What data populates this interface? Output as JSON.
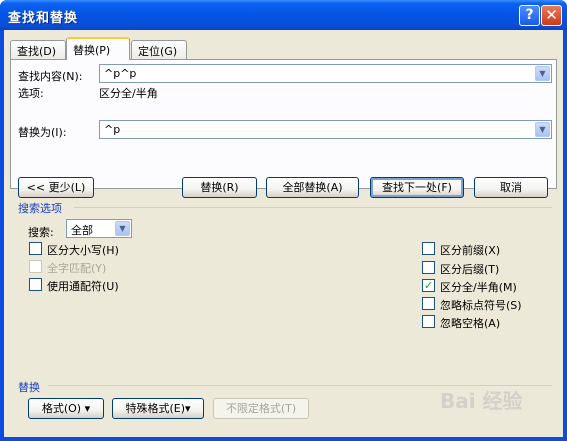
{
  "window": {
    "title": "查找和替换"
  },
  "titlebar": {
    "help_glyph": "?",
    "close_glyph": "✕"
  },
  "tabs": [
    {
      "label": "查找(D)"
    },
    {
      "label": "替换(P)"
    },
    {
      "label": "定位(G)"
    }
  ],
  "find": {
    "label": "查找内容(N):",
    "value": "^p^p"
  },
  "options": {
    "label": "选项:",
    "value": "区分全/半角"
  },
  "replace": {
    "label": "替换为(I):",
    "value": "^p"
  },
  "buttons": {
    "less": "<< 更少(L)",
    "replace": "替换(R)",
    "replace_all": "全部替换(A)",
    "find_next": "查找下一处(F)",
    "cancel": "取消"
  },
  "search_options": {
    "header": "搜索选项",
    "search_label": "搜索:",
    "search_value": "全部",
    "left_checks": [
      {
        "label": "区分大小写(H)",
        "checked": false,
        "disabled": false
      },
      {
        "label": "全字匹配(Y)",
        "checked": false,
        "disabled": true
      },
      {
        "label": "使用通配符(U)",
        "checked": false,
        "disabled": false
      }
    ],
    "right_checks": [
      {
        "label": "区分前缀(X)",
        "checked": false
      },
      {
        "label": "区分后缀(T)",
        "checked": false
      },
      {
        "label": "区分全/半角(M)",
        "checked": true
      },
      {
        "label": "忽略标点符号(S)",
        "checked": false
      },
      {
        "label": "忽略空格(A)",
        "checked": false
      }
    ]
  },
  "replace_section": {
    "header": "替换",
    "format": "格式(O) ▾",
    "special": "特殊格式(E)▾",
    "no_format": "不限定格式(T)"
  },
  "watermark": "Bai 经验",
  "check_mark": "✓",
  "arrow_glyph": "▼"
}
